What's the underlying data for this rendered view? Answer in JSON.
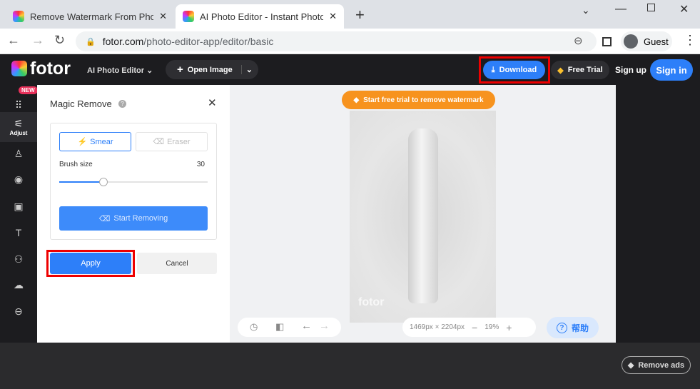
{
  "browser": {
    "tabs": [
      {
        "title": "Remove Watermark From Photo"
      },
      {
        "title": "AI Photo Editor - Instant Photo E"
      }
    ],
    "url_domain": "fotor.com",
    "url_path": "/photo-editor-app/editor/basic",
    "profile": "Guest"
  },
  "header": {
    "logo": "fotor",
    "product": "AI Photo Editor",
    "open_image": "Open Image",
    "download": "Download",
    "free_trial": "Free Trial",
    "sign_up": "Sign up",
    "sign_in": "Sign in"
  },
  "sidebar": {
    "new_badge": "NEW",
    "adjust": "Adjust"
  },
  "panel": {
    "title": "Magic Remove",
    "smear": "Smear",
    "eraser": "Eraser",
    "brush_label": "Brush size",
    "brush_value": "30",
    "brush_fraction": 0.3,
    "start": "Start Removing",
    "apply": "Apply",
    "cancel": "Cancel"
  },
  "canvas": {
    "banner": "Start free trial to remove watermark",
    "watermark": "fotor",
    "dimensions": "1469px × 2204px",
    "zoom": "19%",
    "help": "帮助"
  },
  "footer": {
    "remove_ads": "Remove ads"
  },
  "colors": {
    "accent": "#2d7ff9",
    "orange": "#f7931e",
    "highlight": "#e00000"
  }
}
